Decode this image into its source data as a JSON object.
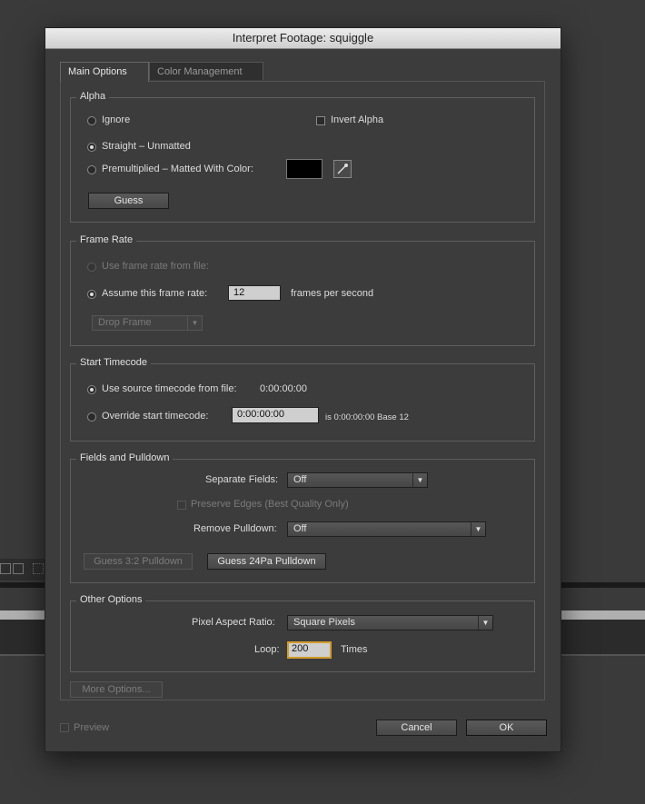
{
  "dialog": {
    "title": "Interpret Footage: squiggle",
    "tabs": [
      "Main Options",
      "Color Management"
    ]
  },
  "alpha": {
    "title": "Alpha",
    "ignore": "Ignore",
    "invert": "Invert Alpha",
    "straight": "Straight – Unmatted",
    "premultiplied": "Premultiplied – Matted With Color:",
    "matte_color": "#000000",
    "guess": "Guess"
  },
  "frame_rate": {
    "title": "Frame Rate",
    "use_file": "Use frame rate from file:",
    "assume": "Assume this frame rate:",
    "value": "12",
    "unit": "frames per second",
    "drop_frame": "Drop Frame"
  },
  "timecode": {
    "title": "Start Timecode",
    "use_source": "Use source timecode from file:",
    "source_value": "0:00:00:00",
    "override": "Override start timecode:",
    "override_value": "0:00:00:00",
    "info": "is 0:00:00:00  Base 12"
  },
  "fields": {
    "title": "Fields and Pulldown",
    "separate_label": "Separate Fields:",
    "separate_value": "Off",
    "preserve": "Preserve Edges (Best Quality Only)",
    "remove_label": "Remove Pulldown:",
    "remove_value": "Off",
    "guess32": "Guess 3:2 Pulldown",
    "guess24": "Guess 24Pa Pulldown"
  },
  "other": {
    "title": "Other Options",
    "par_label": "Pixel Aspect Ratio:",
    "par_value": "Square Pixels",
    "loop_label": "Loop:",
    "loop_value": "200",
    "times": "Times"
  },
  "footer": {
    "more": "More Options...",
    "preview": "Preview",
    "cancel": "Cancel",
    "ok": "OK"
  }
}
